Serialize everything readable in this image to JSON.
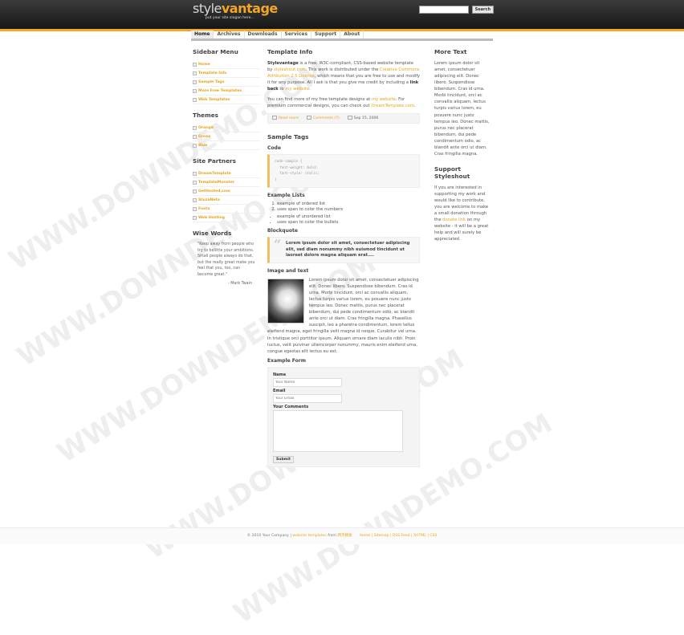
{
  "header": {
    "logo_part1": "style",
    "logo_part2": "vantage",
    "slogan": "put your site slogan here...",
    "search_placeholder": "",
    "search_button": "Search",
    "accent": "#f5a623"
  },
  "nav": [
    "Home",
    "Archives",
    "Downloads",
    "Services",
    "Support",
    "About"
  ],
  "sidebar": {
    "menu_title": "Sidebar Menu",
    "menu": [
      "Home",
      "Template Info",
      "Sample Tags",
      "More Free Templates",
      "Web Templates"
    ],
    "themes_title": "Themes",
    "themes": [
      "Orange",
      "Green",
      "Blue"
    ],
    "partners_title": "Site Partners",
    "partners": [
      "DreamTemplate",
      "TemplateMonster",
      "GetHosted.com",
      "StuzaNeta",
      "Fonts",
      "Web Hosting"
    ],
    "wise_title": "Wise Words",
    "quote": "\"Keep away from people who try to belittle your ambitions. Small people always do that, but the really great make you feel that you, too, can become great.\"",
    "quote_author": "- Mark Twain"
  },
  "main": {
    "template_title": "Template Info",
    "p1_strong": "Stylevantage",
    "p1_a": " is a free, W3C-compliant, CSS-based website template by ",
    "p1_link1": "styleshout.com",
    "p1_b": ". This work is distributed under the ",
    "p1_link2": "Creative Commons Attribution 2.5 License",
    "p1_c": ", which means that you are free to use and modify it for any purpose. All I ask is that you give me credit by including a ",
    "p1_strong2": "link back",
    "p1_d": " to ",
    "p1_link3": "my website",
    "p1_e": ".",
    "p2_a": "You can find more of my free template designs at ",
    "p2_link1": "my website",
    "p2_b": ". For premium commercial designs, you can check out ",
    "p2_link2": "DreamTemplate.com",
    "p2_c": ".",
    "read_more": "Read more",
    "comments": "Comments (7)",
    "date": "Sep 15, 2006",
    "sample_title": "Sample Tags",
    "code_title": "Code",
    "code_lines": [
      "code-sample {",
      "  font-weight: bold;",
      "  font-style: italic;",
      "}"
    ],
    "lists_title": "Example Lists",
    "ordered": [
      "example of ordered list",
      "uses span to color the numbers"
    ],
    "unordered": [
      "example of unordered list",
      "uses span to color the bullets"
    ],
    "blockquote_title": "Blockquote",
    "blockquote": "Lorem ipsum dolor sit amet, consectetuer adipiscing elit, sed diam nonummy nibh euismod tincidunt ut laoreet dolore magna aliquam erat....",
    "image_title": "Image and text",
    "image_text": "Lorem ipsum dolor sit amet, consectetuer adipiscing elit. Donec libero. Suspendisse bibendum. Cras id urna. Morbi tincidunt, orci ac convallis aliquam, lectus turpis varius lorem, eu posuere nunc justo tempus leo. Donec mattis, purus nec placerat bibendum, dui pede condimentum odio, ac blandit ante orci ut diam. Cras fringilla magna. Phasellus suscipit, leo a pharetra condimentum, lorem tellus eleifend magna, eget fringilla velit magna id neque. Curabitur vel urna. In tristique orci porttitor ipsum. Aliquam ornare diam iaculis nibh. Proin luctus, velit pulvinar ullamcorper nonummy, mauris enim eleifend urna, congue egestas elit lectus eu est.",
    "form_title": "Example Form",
    "name_label": "Name",
    "name_placeholder": "Your Name",
    "email_label": "Email",
    "email_placeholder": "Your Email",
    "comments_label": "Your Comments",
    "submit": "Submit"
  },
  "right": {
    "more_title": "More Text",
    "more_text": "Lorem ipsum dolor sit amet, consectetuer adipiscing elit. Donec libero. Suspendisse bibendum. Cras id urna. Morbi tincidunt, orci ac convallis aliquam, lectus turpis varius lorem, eu posuere nunc justo tempus leo. Donec mattis, purus nec placerat bibendum, dui pede condimentum odio, ac blandit ante orci ut diam. Cras fringilla magna.",
    "support_title": "Support Styleshout",
    "support_a": "If you are interested in supporting my work and would like to contribute, you are welcome to make a small donation through the ",
    "support_link": "donate link",
    "support_b": " on my website - it will be a great help and will surely be appreciated."
  },
  "footer": {
    "copy": "© 2010 Your Company | ",
    "link1": "website templates",
    "from": " from ",
    "link2": "网页模板",
    "links": "Home | Sitemap | RSS Feed | XHTML | CSS"
  },
  "watermark": "WWW.DOWNDEMO.COM"
}
